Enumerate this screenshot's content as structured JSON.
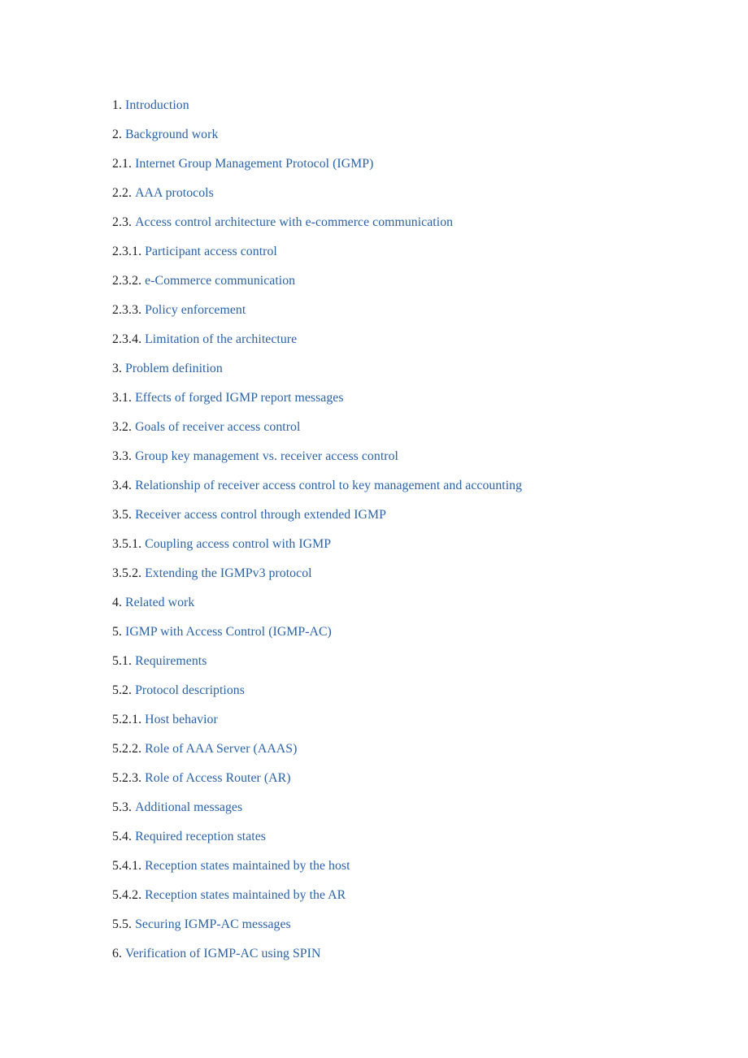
{
  "document": {
    "kind": "table-of-contents",
    "background_color": "#ffffff",
    "number_color": "#1c1c1c",
    "link_color": "#2a62a8"
  },
  "toc": {
    "items": [
      {
        "number": "1.",
        "title": "Introduction"
      },
      {
        "number": "2.",
        "title": "Background work"
      },
      {
        "number": "2.1.",
        "title": "Internet Group Management Protocol (IGMP)"
      },
      {
        "number": "2.2.",
        "title": "AAA protocols"
      },
      {
        "number": "2.3.",
        "title": "Access control architecture with e-commerce communication"
      },
      {
        "number": "2.3.1.",
        "title": "Participant access control"
      },
      {
        "number": "2.3.2.",
        "title": "e-Commerce communication"
      },
      {
        "number": "2.3.3.",
        "title": "Policy enforcement"
      },
      {
        "number": "2.3.4.",
        "title": "Limitation of the architecture"
      },
      {
        "number": "3.",
        "title": "Problem definition"
      },
      {
        "number": "3.1.",
        "title": "Effects of forged IGMP report messages"
      },
      {
        "number": "3.2.",
        "title": "Goals of receiver access control"
      },
      {
        "number": "3.3.",
        "title": "Group key management vs. receiver access control"
      },
      {
        "number": "3.4.",
        "title": "Relationship of receiver access control to key management and accounting"
      },
      {
        "number": "3.5.",
        "title": "Receiver access control through extended IGMP"
      },
      {
        "number": "3.5.1.",
        "title": "Coupling access control with IGMP"
      },
      {
        "number": "3.5.2.",
        "title": "Extending the IGMPv3 protocol"
      },
      {
        "number": "4.",
        "title": "Related work"
      },
      {
        "number": "5.",
        "title": "IGMP with Access Control (IGMP-AC)"
      },
      {
        "number": "5.1.",
        "title": "Requirements"
      },
      {
        "number": "5.2.",
        "title": "Protocol descriptions"
      },
      {
        "number": "5.2.1.",
        "title": "Host behavior"
      },
      {
        "number": "5.2.2.",
        "title": "Role of AAA Server (AAAS)"
      },
      {
        "number": "5.2.3.",
        "title": "Role of Access Router (AR)"
      },
      {
        "number": "5.3.",
        "title": "Additional messages"
      },
      {
        "number": "5.4.",
        "title": "Required reception states"
      },
      {
        "number": "5.4.1.",
        "title": "Reception states maintained by the host"
      },
      {
        "number": "5.4.2.",
        "title": "Reception states maintained by the AR"
      },
      {
        "number": "5.5.",
        "title": "Securing IGMP-AC messages"
      },
      {
        "number": "6.",
        "title": "Verification of IGMP-AC using SPIN"
      }
    ]
  }
}
